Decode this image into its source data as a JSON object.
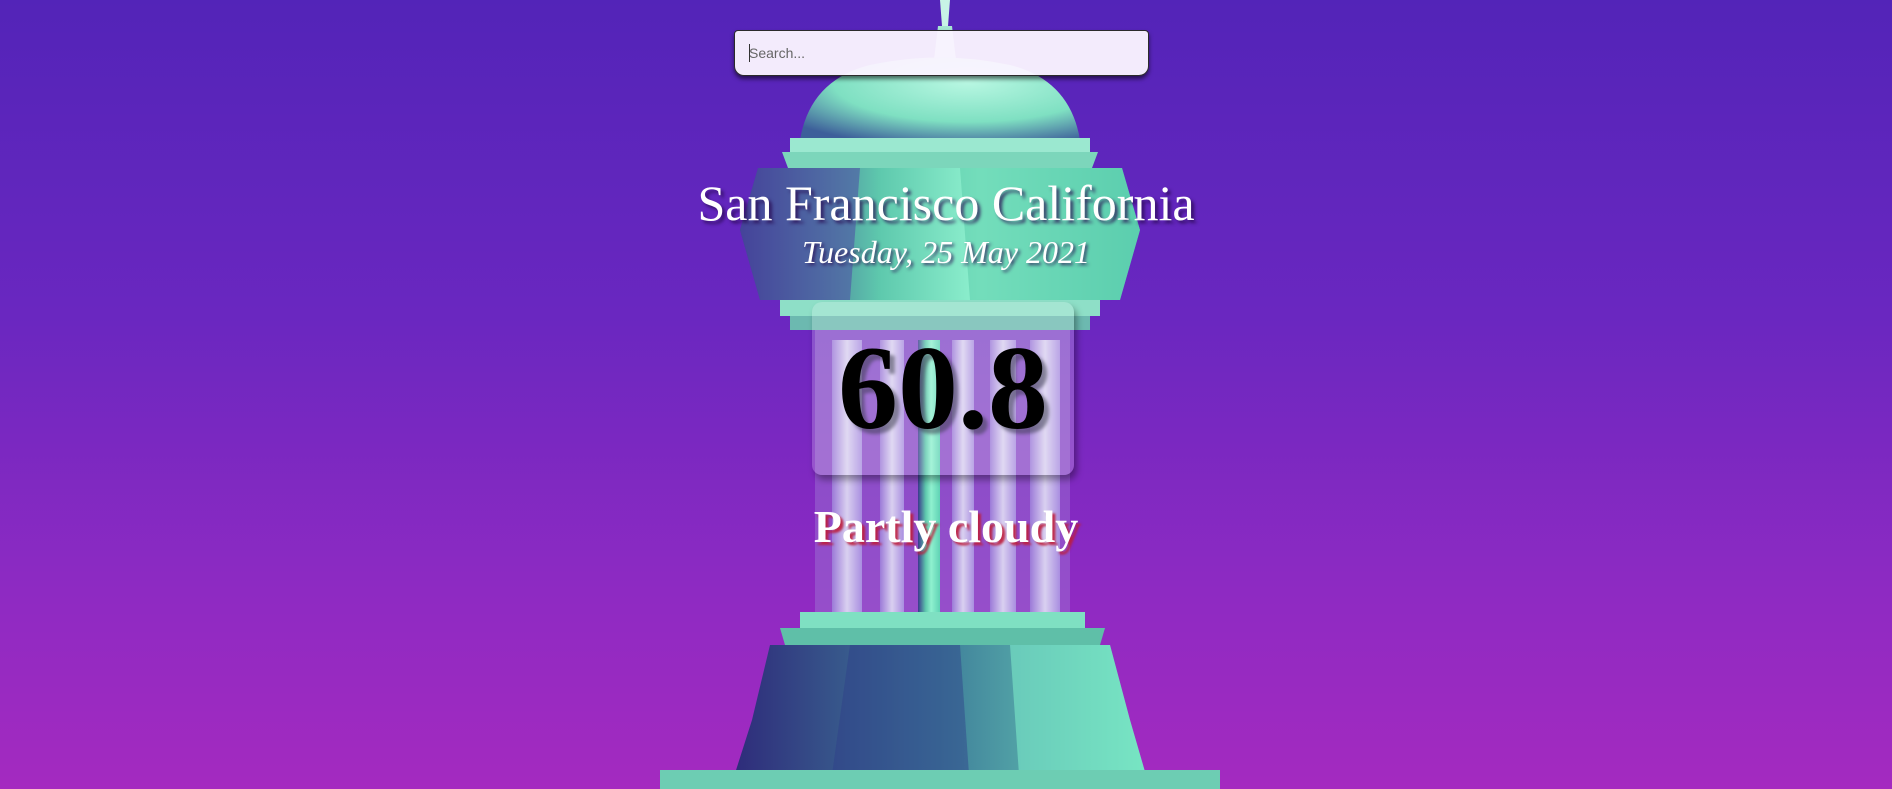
{
  "search": {
    "placeholder": "Search...",
    "value": ""
  },
  "weather": {
    "location": "San Francisco California",
    "date": "Tuesday, 25 May 2021",
    "temperature": "60.8",
    "condition": "Partly cloudy"
  },
  "colors": {
    "background_top": "#5324b8",
    "background_bottom": "#a42ac0",
    "dome_mint": "#7fe8c4",
    "text": "#ffffff",
    "temperature_text": "#000000",
    "condition_shadow": "#be1e3c"
  }
}
